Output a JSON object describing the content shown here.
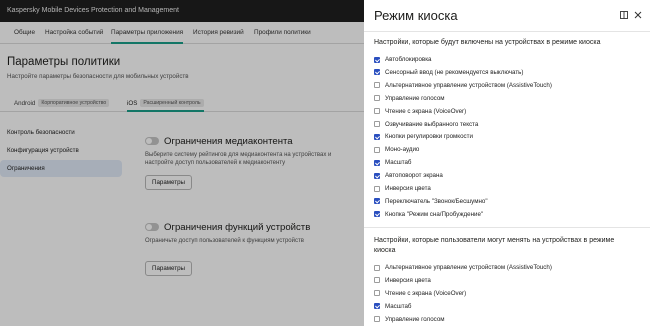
{
  "app": {
    "title": "Kaspersky Mobile Devices Protection and Management",
    "nav_tabs": [
      {
        "label": "Общие",
        "active": false
      },
      {
        "label": "Настройка событий",
        "active": false
      },
      {
        "label": "Параметры приложения",
        "active": true
      },
      {
        "label": "История ревизий",
        "active": false
      },
      {
        "label": "Профили политики",
        "active": false
      }
    ],
    "page_title": "Параметры политики",
    "page_subtitle": "Настройте параметры безопасности для мобильных устройств",
    "os_tabs": [
      {
        "label": "Android",
        "tag": "Корпоративное устройство",
        "active": false
      },
      {
        "label": "iOS",
        "tag": "Расширенный контроль",
        "active": true
      }
    ],
    "side_nav": [
      {
        "label": "Контроль безопасности",
        "active": false
      },
      {
        "label": "Конфигурация устройств",
        "active": false
      },
      {
        "label": "Ограничения",
        "active": true
      }
    ],
    "sections": [
      {
        "title": "Ограничения медиаконтента",
        "description": "Выберите систему рейтингов для медиаконтента на устройствах и настройте доступ пользователей к медиаконтенту",
        "button": "Параметры",
        "enabled": false
      },
      {
        "title": "Ограничения функций устройств",
        "description": "Ограничьте доступ пользователей к функциям устройств",
        "button": "Параметры",
        "enabled": false
      }
    ]
  },
  "drawer": {
    "title": "Режим киоска",
    "icons": [
      "expand-icon",
      "close-icon"
    ],
    "group1": {
      "heading": "Настройки, которые будут включены на устройствах в режиме киоска",
      "options": [
        {
          "label": "Автоблокировка",
          "checked": true
        },
        {
          "label": "Сенсорный ввод (не рекомендуется выключать)",
          "checked": true
        },
        {
          "label": "Альтернативное управление устройством (AssistiveTouch)",
          "checked": false
        },
        {
          "label": "Управление голосом",
          "checked": false
        },
        {
          "label": "Чтение с экрана (VoiceOver)",
          "checked": false
        },
        {
          "label": "Озвучивание выбранного текста",
          "checked": false
        },
        {
          "label": "Кнопки регулировки громкости",
          "checked": true
        },
        {
          "label": "Моно-аудио",
          "checked": false
        },
        {
          "label": "Масштаб",
          "checked": true
        },
        {
          "label": "Автоповорот экрана",
          "checked": true
        },
        {
          "label": "Инверсия цвета",
          "checked": false
        },
        {
          "label": "Переключатель \"Звонок/Бесшумно\"",
          "checked": true
        },
        {
          "label": "Кнопка \"Режим сна/Пробуждение\"",
          "checked": true
        }
      ]
    },
    "group2": {
      "heading": "Настройки, которые пользователи могут менять на устройствах в режиме киоска",
      "options": [
        {
          "label": "Альтернативное управление устройством (AssistiveTouch)",
          "checked": false
        },
        {
          "label": "Инверсия цвета",
          "checked": false
        },
        {
          "label": "Чтение с экрана (VoiceOver)",
          "checked": false
        },
        {
          "label": "Масштаб",
          "checked": true
        },
        {
          "label": "Управление голосом",
          "checked": false
        }
      ]
    }
  },
  "colors": {
    "accent": "#1aa08a",
    "checkbox": "#2a4fbf",
    "topbar": "#1f1f1f"
  }
}
